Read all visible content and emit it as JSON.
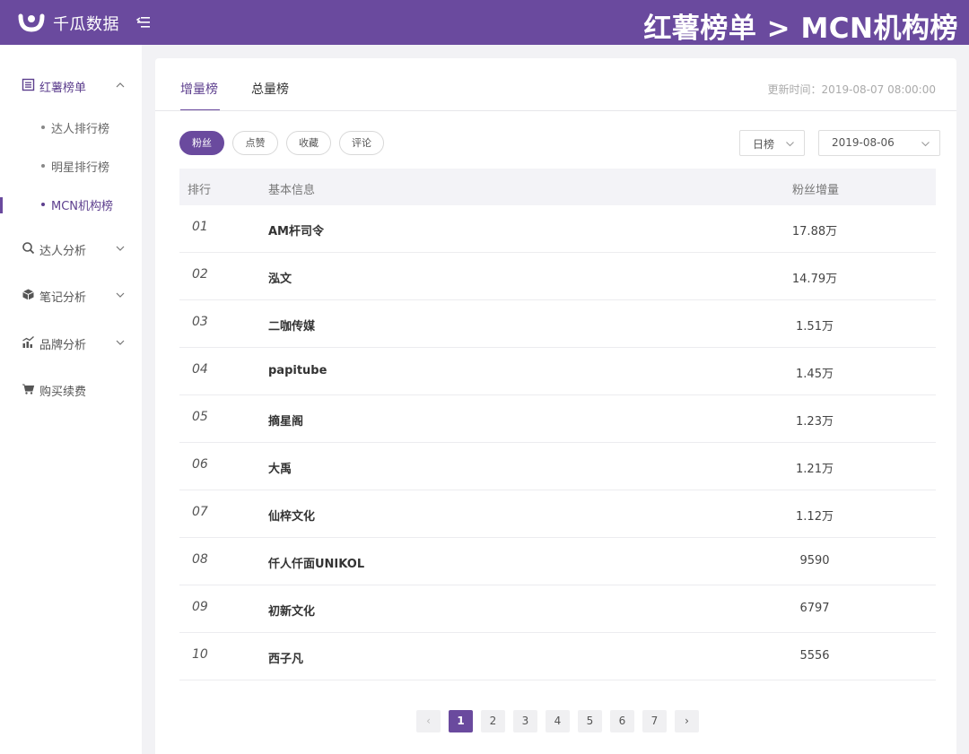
{
  "header": {
    "brand": "千瓜数据",
    "page_title": "红薯榜单 > MCN机构榜",
    "brand_color": "#6a4a9e"
  },
  "sidebar": {
    "groups": [
      {
        "label": "红薯榜单",
        "icon": "list-icon",
        "expanded": true
      },
      {
        "label": "达人分析",
        "icon": "search-icon",
        "expanded": false
      },
      {
        "label": "笔记分析",
        "icon": "box-icon",
        "expanded": false
      },
      {
        "label": "品牌分析",
        "icon": "bar-trend-icon",
        "expanded": false
      },
      {
        "label": "购买续费",
        "icon": "cart-icon"
      }
    ],
    "sub_items": [
      {
        "label": "达人排行榜"
      },
      {
        "label": "明星排行榜"
      },
      {
        "label": "MCN机构榜",
        "active": true
      }
    ]
  },
  "main": {
    "tabs": [
      {
        "label": "增量榜",
        "active": true
      },
      {
        "label": "总量榜"
      }
    ],
    "update_time": "更新时间：2019-08-07 08:00:00",
    "filters": [
      {
        "label": "粉丝",
        "active": true
      },
      {
        "label": "点赞"
      },
      {
        "label": "收藏"
      },
      {
        "label": "评论"
      }
    ],
    "period_select": "日榜",
    "date_select": "2019-08-06",
    "table": {
      "columns": [
        "排行",
        "基本信息",
        "粉丝增量"
      ],
      "rows": [
        {
          "rank": "01",
          "name": "AM杆司令",
          "gain": "17.88万"
        },
        {
          "rank": "02",
          "name": "泓文",
          "gain": "14.79万"
        },
        {
          "rank": "03",
          "name": "二咖传媒",
          "gain": "1.51万"
        },
        {
          "rank": "04",
          "name": "papitube",
          "gain": "1.45万"
        },
        {
          "rank": "05",
          "name": "摘星阁",
          "gain": "1.23万"
        },
        {
          "rank": "06",
          "name": "大禹",
          "gain": "1.21万"
        },
        {
          "rank": "07",
          "name": "仙梓文化",
          "gain": "1.12万"
        },
        {
          "rank": "08",
          "name": "仟人仟面UNIKOL",
          "gain": "9590"
        },
        {
          "rank": "09",
          "name": "初新文化",
          "gain": "6797"
        },
        {
          "rank": "10",
          "name": "西子凡",
          "gain": "5556"
        }
      ]
    },
    "pagination": {
      "prev": "‹",
      "next": "›",
      "pages": [
        "1",
        "2",
        "3",
        "4",
        "5",
        "6",
        "7"
      ],
      "current": "1"
    }
  }
}
